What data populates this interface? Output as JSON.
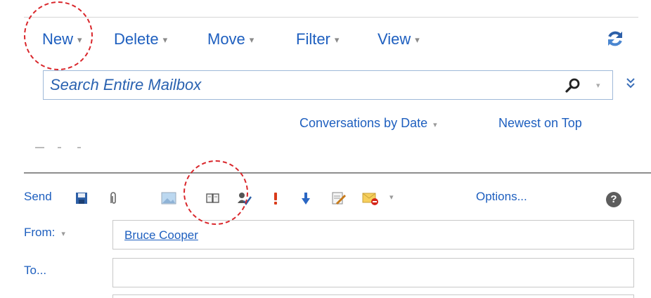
{
  "toolbar": {
    "new_label": "New",
    "delete_label": "Delete",
    "move_label": "Move",
    "filter_label": "Filter",
    "view_label": "View",
    "dropdown_arrow": "▾"
  },
  "search": {
    "placeholder": "Search Entire Mailbox"
  },
  "sort": {
    "arrange_label": "Conversations by Date",
    "order_label": "Newest on Top"
  },
  "compose": {
    "send_label": "Send",
    "options_label": "Options...",
    "help_glyph": "?",
    "icons": [
      "save-icon",
      "attach-icon",
      "insert-picture-icon",
      "address-book-icon",
      "check-names-icon",
      "high-importance-icon",
      "low-importance-icon",
      "signature-icon",
      "message-flag-icon"
    ],
    "from_label": "From:",
    "from_value": "Bruce Cooper",
    "to_label": "To..."
  },
  "colors": {
    "link_blue": "#1e5fbf",
    "callout_red": "#d9262b"
  }
}
